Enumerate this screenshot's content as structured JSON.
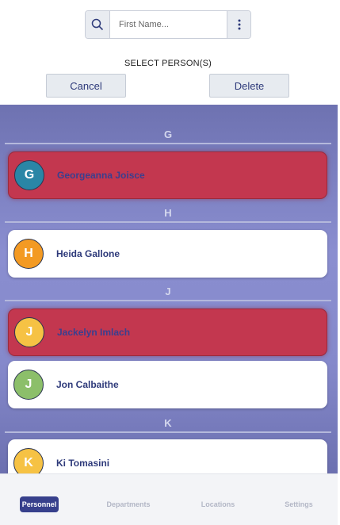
{
  "search": {
    "placeholder": "First Name..."
  },
  "header": {
    "title": "SELECT PERSON(S)",
    "cancel_label": "Cancel",
    "delete_label": "Delete"
  },
  "colors": {
    "selected": "#c3374f",
    "accent": "#37408c",
    "list_bg": "#8589cb"
  },
  "sections": [
    {
      "letter": "G",
      "people": [
        {
          "initial": "G",
          "name": "Georgeanna Joisce",
          "selected": true,
          "avatar_color": "#2a86a6"
        }
      ]
    },
    {
      "letter": "H",
      "people": [
        {
          "initial": "H",
          "name": "Heida Gallone",
          "selected": false,
          "avatar_color": "#f39a23"
        }
      ]
    },
    {
      "letter": "J",
      "people": [
        {
          "initial": "J",
          "name": "Jackelyn Imlach",
          "selected": true,
          "avatar_color": "#f6c244"
        },
        {
          "initial": "J",
          "name": "Jon Calbaithe",
          "selected": false,
          "avatar_color": "#8cbf6a"
        }
      ]
    },
    {
      "letter": "K",
      "people": [
        {
          "initial": "K",
          "name": "Ki Tomasini",
          "selected": false,
          "avatar_color": "#f6c244"
        }
      ]
    }
  ],
  "nav": [
    {
      "label": "Personnel",
      "active": true
    },
    {
      "label": "Departments",
      "active": false
    },
    {
      "label": "Locations",
      "active": false
    },
    {
      "label": "Settings",
      "active": false
    }
  ]
}
